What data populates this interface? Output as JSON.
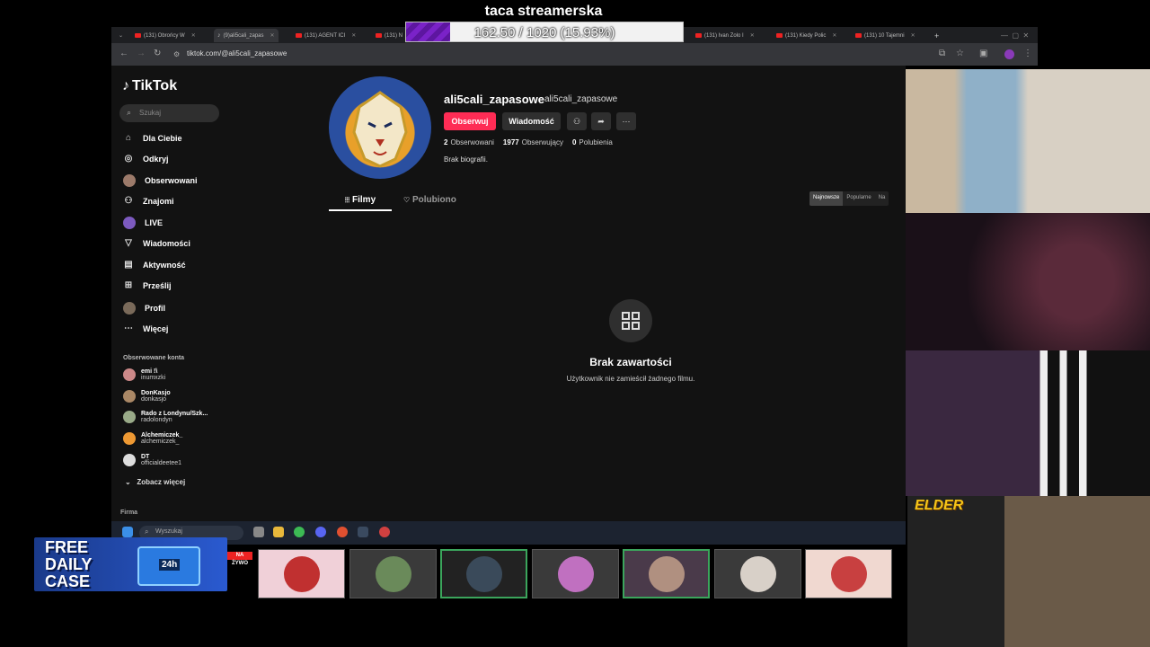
{
  "overlay": {
    "title": "taca streamerska",
    "goal_text": "162.50 / 1020 (15.93%)",
    "goal_fraction": 0.1593
  },
  "browser": {
    "tabs": [
      {
        "label": "(131) Obrońcy W",
        "icon": "youtube-icon"
      },
      {
        "label": "(9)ali5cali_zapas",
        "icon": "tiktok-icon",
        "active": true
      },
      {
        "label": "(131) AGENT ICI",
        "icon": "youtube-icon"
      },
      {
        "label": "(131) N",
        "icon": "youtube-icon"
      },
      {
        "label": "(131) Ivan Zolo I",
        "icon": "youtube-icon"
      },
      {
        "label": "(131) Kiedy Polic",
        "icon": "youtube-icon"
      },
      {
        "label": "(131) 10 Tajemni",
        "icon": "youtube-icon"
      }
    ],
    "url": "tiktok.com/@ali5cali_zapasowe"
  },
  "tiktok": {
    "logo": "TikTok",
    "search_placeholder": "Szukaj",
    "nav": [
      {
        "label": "Dla Ciebie",
        "icon": "home-icon"
      },
      {
        "label": "Odkryj",
        "icon": "compass-icon"
      },
      {
        "label": "Obserwowani",
        "icon": "avatar-icon"
      },
      {
        "label": "Znajomi",
        "icon": "users-icon"
      },
      {
        "label": "LIVE",
        "icon": "live-icon"
      },
      {
        "label": "Wiadomości",
        "icon": "message-icon"
      },
      {
        "label": "Aktywność",
        "icon": "activity-icon"
      },
      {
        "label": "Prześlij",
        "icon": "upload-icon"
      },
      {
        "label": "Profil",
        "icon": "profile-icon"
      },
      {
        "label": "Więcej",
        "icon": "more-icon"
      }
    ],
    "followed_title": "Obserwowane konta",
    "followed": [
      {
        "name": "emi !\\",
        "handle": "inumxzki",
        "color": "#c88"
      },
      {
        "name": "DonKasjo",
        "handle": "donkasjo",
        "color": "#a86"
      },
      {
        "name": "Rado z Londynu/Szk...",
        "handle": "radolondyn",
        "color": "#9a8"
      },
      {
        "name": "Alchemiczek_",
        "handle": "alchemiczek_",
        "color": "#e93"
      },
      {
        "name": "DT",
        "handle": "officialdeetee1",
        "color": "#ddd"
      }
    ],
    "see_more": "Zobacz więcej",
    "company": "Firma",
    "profile": {
      "username": "ali5cali_zapasowe",
      "nickname": "ali5cali_zapasowe",
      "follow_label": "Obserwuj",
      "message_label": "Wiadomość",
      "following_count": "2",
      "following_label": "Obserwowani",
      "followers_count": "1977",
      "followers_label": "Obserwujący",
      "likes_count": "0",
      "likes_label": "Polubienia",
      "bio": "Brak biografii."
    },
    "tabs": {
      "films": "Filmy",
      "liked": "Polubiono"
    },
    "sort": [
      "Najnowsze",
      "Popularne",
      "Na"
    ],
    "empty_title": "Brak zawartości",
    "empty_sub": "Użytkownik nie zamieścił żadnego filmu."
  },
  "taskbar": {
    "search_placeholder": "Wyszukaj"
  },
  "bottom": {
    "free_case_line1": "FREE",
    "free_case_line2": "DAILY",
    "free_case_line3": "CASE",
    "free_case_badge": "24h",
    "live_badge": "NA ŻYWO",
    "cam_logo": "ELDER"
  }
}
